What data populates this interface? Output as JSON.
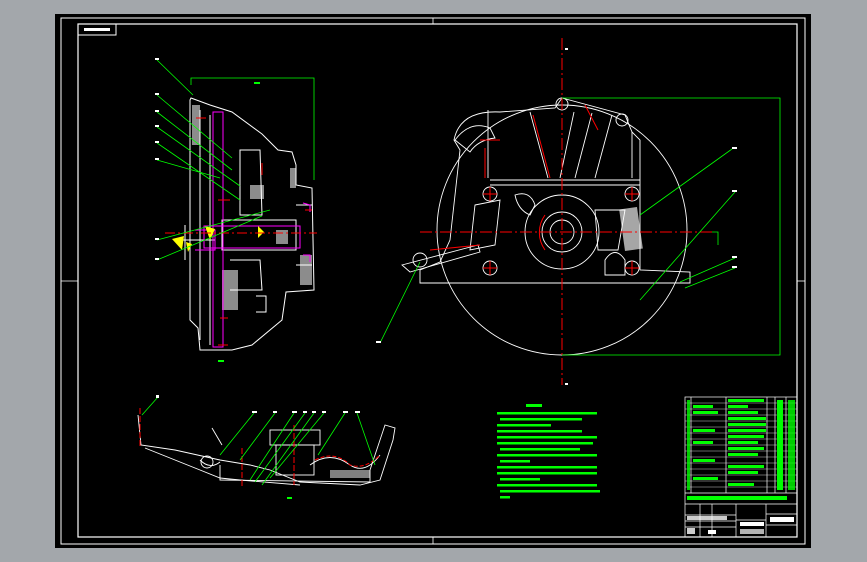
{
  "drawing": {
    "background": "#000000",
    "viewport_background": "#a3a7ab",
    "colors": {
      "outline": "#ffffff",
      "centerline": "#ff0000",
      "leader": "#00ff00",
      "hidden_part": "#ff00ff",
      "highlight": "#ffff00"
    },
    "views": [
      "section-view",
      "front-view",
      "linkage-view",
      "technical-notes",
      "parts-list",
      "title-block"
    ]
  }
}
